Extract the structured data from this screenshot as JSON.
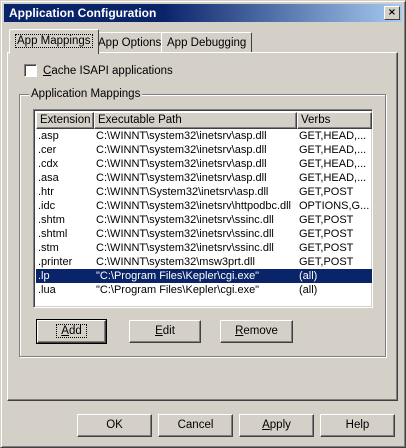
{
  "window": {
    "title": "Application Configuration",
    "close_glyph": "×"
  },
  "tabs": [
    {
      "label": "App Mappings",
      "active": true
    },
    {
      "label": "App Options",
      "active": false
    },
    {
      "label": "App Debugging",
      "active": false
    }
  ],
  "cache_isapi": {
    "label_underlined": "C",
    "label_rest": "ache ISAPI applications",
    "checked": false
  },
  "mappings_group": {
    "label": "Application Mappings"
  },
  "list": {
    "headers": {
      "extension": "Extension",
      "path": "Executable Path",
      "verbs": "Verbs"
    },
    "rows": [
      {
        "ext": ".asp",
        "path": "C:\\WINNT\\system32\\inetsrv\\asp.dll",
        "verbs": "GET,HEAD,..."
      },
      {
        "ext": ".cer",
        "path": "C:\\WINNT\\system32\\inetsrv\\asp.dll",
        "verbs": "GET,HEAD,..."
      },
      {
        "ext": ".cdx",
        "path": "C:\\WINNT\\system32\\inetsrv\\asp.dll",
        "verbs": "GET,HEAD,..."
      },
      {
        "ext": ".asa",
        "path": "C:\\WINNT\\system32\\inetsrv\\asp.dll",
        "verbs": "GET,HEAD,..."
      },
      {
        "ext": ".htr",
        "path": "C:\\WINNT\\System32\\inetsrv\\asp.dll",
        "verbs": "GET,POST"
      },
      {
        "ext": ".idc",
        "path": "C:\\WINNT\\system32\\inetsrv\\httpodbc.dll",
        "verbs": "OPTIONS,G..."
      },
      {
        "ext": ".shtm",
        "path": "C:\\WINNT\\system32\\inetsrv\\ssinc.dll",
        "verbs": "GET,POST"
      },
      {
        "ext": ".shtml",
        "path": "C:\\WINNT\\system32\\inetsrv\\ssinc.dll",
        "verbs": "GET,POST"
      },
      {
        "ext": ".stm",
        "path": "C:\\WINNT\\system32\\inetsrv\\ssinc.dll",
        "verbs": "GET,POST"
      },
      {
        "ext": ".printer",
        "path": "C:\\WINNT\\system32\\msw3prt.dll",
        "verbs": "GET,POST"
      },
      {
        "ext": ".lp",
        "path": "\"C:\\Program Files\\Kepler\\cgi.exe\"",
        "verbs": "(all)"
      },
      {
        "ext": ".lua",
        "path": "\"C:\\Program Files\\Kepler\\cgi.exe\"",
        "verbs": "(all)"
      }
    ],
    "selected_index": 10
  },
  "group_buttons": {
    "add": {
      "ul": "A",
      "rest": "dd"
    },
    "edit": {
      "ul": "E",
      "rest": "dit"
    },
    "remove": {
      "ul": "R",
      "rest": "emove"
    }
  },
  "dialog_buttons": {
    "ok": "OK",
    "cancel": "Cancel",
    "apply": {
      "ul": "A",
      "rest": "pply"
    },
    "help": "Help"
  },
  "colors": {
    "face": "#d4d0c8",
    "title_active": "#0a246a",
    "selection": "#0a246a"
  }
}
